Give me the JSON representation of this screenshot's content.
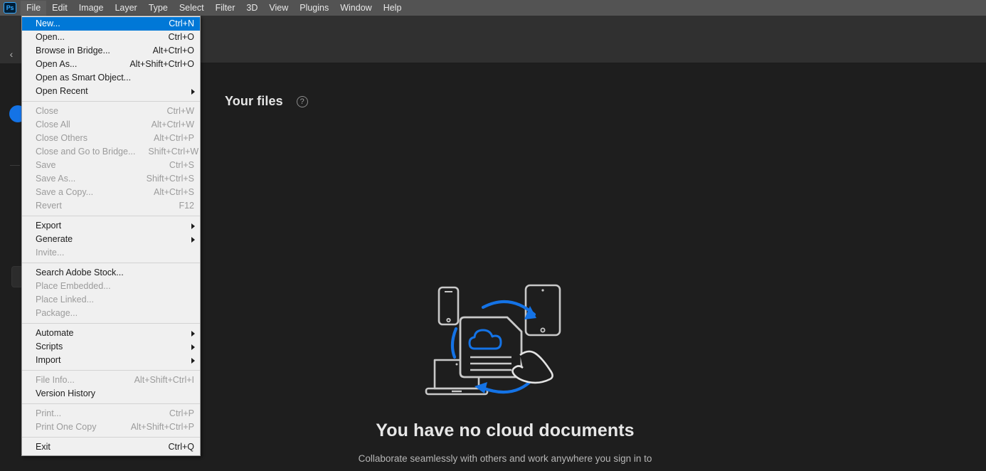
{
  "app": {
    "logo_text": "Ps",
    "menubar": [
      {
        "label": "File",
        "active": true
      },
      {
        "label": "Edit",
        "active": false
      },
      {
        "label": "Image",
        "active": false
      },
      {
        "label": "Layer",
        "active": false
      },
      {
        "label": "Type",
        "active": false
      },
      {
        "label": "Select",
        "active": false
      },
      {
        "label": "Filter",
        "active": false
      },
      {
        "label": "3D",
        "active": false
      },
      {
        "label": "View",
        "active": false
      },
      {
        "label": "Plugins",
        "active": false
      },
      {
        "label": "Window",
        "active": false
      },
      {
        "label": "Help",
        "active": false
      }
    ]
  },
  "rail": {
    "collapse_icon": "‹",
    "avatar_name": "user-avatar"
  },
  "home": {
    "files_title": "Your files",
    "help_glyph": "?",
    "empty": {
      "title": "You have no cloud documents",
      "subtitle": "Collaborate seamlessly with others and work anywhere you sign in to"
    }
  },
  "file_menu": {
    "items": [
      {
        "type": "item",
        "label": "New...",
        "accel": "Ctrl+N",
        "disabled": false,
        "selected": true,
        "submenu": false
      },
      {
        "type": "item",
        "label": "Open...",
        "accel": "Ctrl+O",
        "disabled": false,
        "selected": false,
        "submenu": false
      },
      {
        "type": "item",
        "label": "Browse in Bridge...",
        "accel": "Alt+Ctrl+O",
        "disabled": false,
        "selected": false,
        "submenu": false
      },
      {
        "type": "item",
        "label": "Open As...",
        "accel": "Alt+Shift+Ctrl+O",
        "disabled": false,
        "selected": false,
        "submenu": false
      },
      {
        "type": "item",
        "label": "Open as Smart Object...",
        "accel": "",
        "disabled": false,
        "selected": false,
        "submenu": false
      },
      {
        "type": "item",
        "label": "Open Recent",
        "accel": "",
        "disabled": false,
        "selected": false,
        "submenu": true
      },
      {
        "type": "sep"
      },
      {
        "type": "item",
        "label": "Close",
        "accel": "Ctrl+W",
        "disabled": true,
        "selected": false,
        "submenu": false
      },
      {
        "type": "item",
        "label": "Close All",
        "accel": "Alt+Ctrl+W",
        "disabled": true,
        "selected": false,
        "submenu": false
      },
      {
        "type": "item",
        "label": "Close Others",
        "accel": "Alt+Ctrl+P",
        "disabled": true,
        "selected": false,
        "submenu": false
      },
      {
        "type": "item",
        "label": "Close and Go to Bridge...",
        "accel": "Shift+Ctrl+W",
        "disabled": true,
        "selected": false,
        "submenu": false
      },
      {
        "type": "item",
        "label": "Save",
        "accel": "Ctrl+S",
        "disabled": true,
        "selected": false,
        "submenu": false
      },
      {
        "type": "item",
        "label": "Save As...",
        "accel": "Shift+Ctrl+S",
        "disabled": true,
        "selected": false,
        "submenu": false
      },
      {
        "type": "item",
        "label": "Save a Copy...",
        "accel": "Alt+Ctrl+S",
        "disabled": true,
        "selected": false,
        "submenu": false
      },
      {
        "type": "item",
        "label": "Revert",
        "accel": "F12",
        "disabled": true,
        "selected": false,
        "submenu": false
      },
      {
        "type": "sep"
      },
      {
        "type": "item",
        "label": "Export",
        "accel": "",
        "disabled": false,
        "selected": false,
        "submenu": true
      },
      {
        "type": "item",
        "label": "Generate",
        "accel": "",
        "disabled": false,
        "selected": false,
        "submenu": true
      },
      {
        "type": "item",
        "label": "Invite...",
        "accel": "",
        "disabled": true,
        "selected": false,
        "submenu": false
      },
      {
        "type": "sep"
      },
      {
        "type": "item",
        "label": "Search Adobe Stock...",
        "accel": "",
        "disabled": false,
        "selected": false,
        "submenu": false
      },
      {
        "type": "item",
        "label": "Place Embedded...",
        "accel": "",
        "disabled": true,
        "selected": false,
        "submenu": false
      },
      {
        "type": "item",
        "label": "Place Linked...",
        "accel": "",
        "disabled": true,
        "selected": false,
        "submenu": false
      },
      {
        "type": "item",
        "label": "Package...",
        "accel": "",
        "disabled": true,
        "selected": false,
        "submenu": false
      },
      {
        "type": "sep"
      },
      {
        "type": "item",
        "label": "Automate",
        "accel": "",
        "disabled": false,
        "selected": false,
        "submenu": true
      },
      {
        "type": "item",
        "label": "Scripts",
        "accel": "",
        "disabled": false,
        "selected": false,
        "submenu": true
      },
      {
        "type": "item",
        "label": "Import",
        "accel": "",
        "disabled": false,
        "selected": false,
        "submenu": true
      },
      {
        "type": "sep"
      },
      {
        "type": "item",
        "label": "File Info...",
        "accel": "Alt+Shift+Ctrl+I",
        "disabled": true,
        "selected": false,
        "submenu": false
      },
      {
        "type": "item",
        "label": "Version History",
        "accel": "",
        "disabled": false,
        "selected": false,
        "submenu": false
      },
      {
        "type": "sep"
      },
      {
        "type": "item",
        "label": "Print...",
        "accel": "Ctrl+P",
        "disabled": true,
        "selected": false,
        "submenu": false
      },
      {
        "type": "item",
        "label": "Print One Copy",
        "accel": "Alt+Shift+Ctrl+P",
        "disabled": true,
        "selected": false,
        "submenu": false
      },
      {
        "type": "sep"
      },
      {
        "type": "item",
        "label": "Exit",
        "accel": "Ctrl+Q",
        "disabled": false,
        "selected": false,
        "submenu": false
      }
    ]
  },
  "colors": {
    "menubar_bg": "#535353",
    "panel_bg": "#303030",
    "canvas_bg": "#1e1e1e",
    "menu_bg": "#f0f0f0",
    "highlight": "#0078d7",
    "accent_blue": "#1473e6",
    "illustration_gray": "#c9c9c9"
  }
}
